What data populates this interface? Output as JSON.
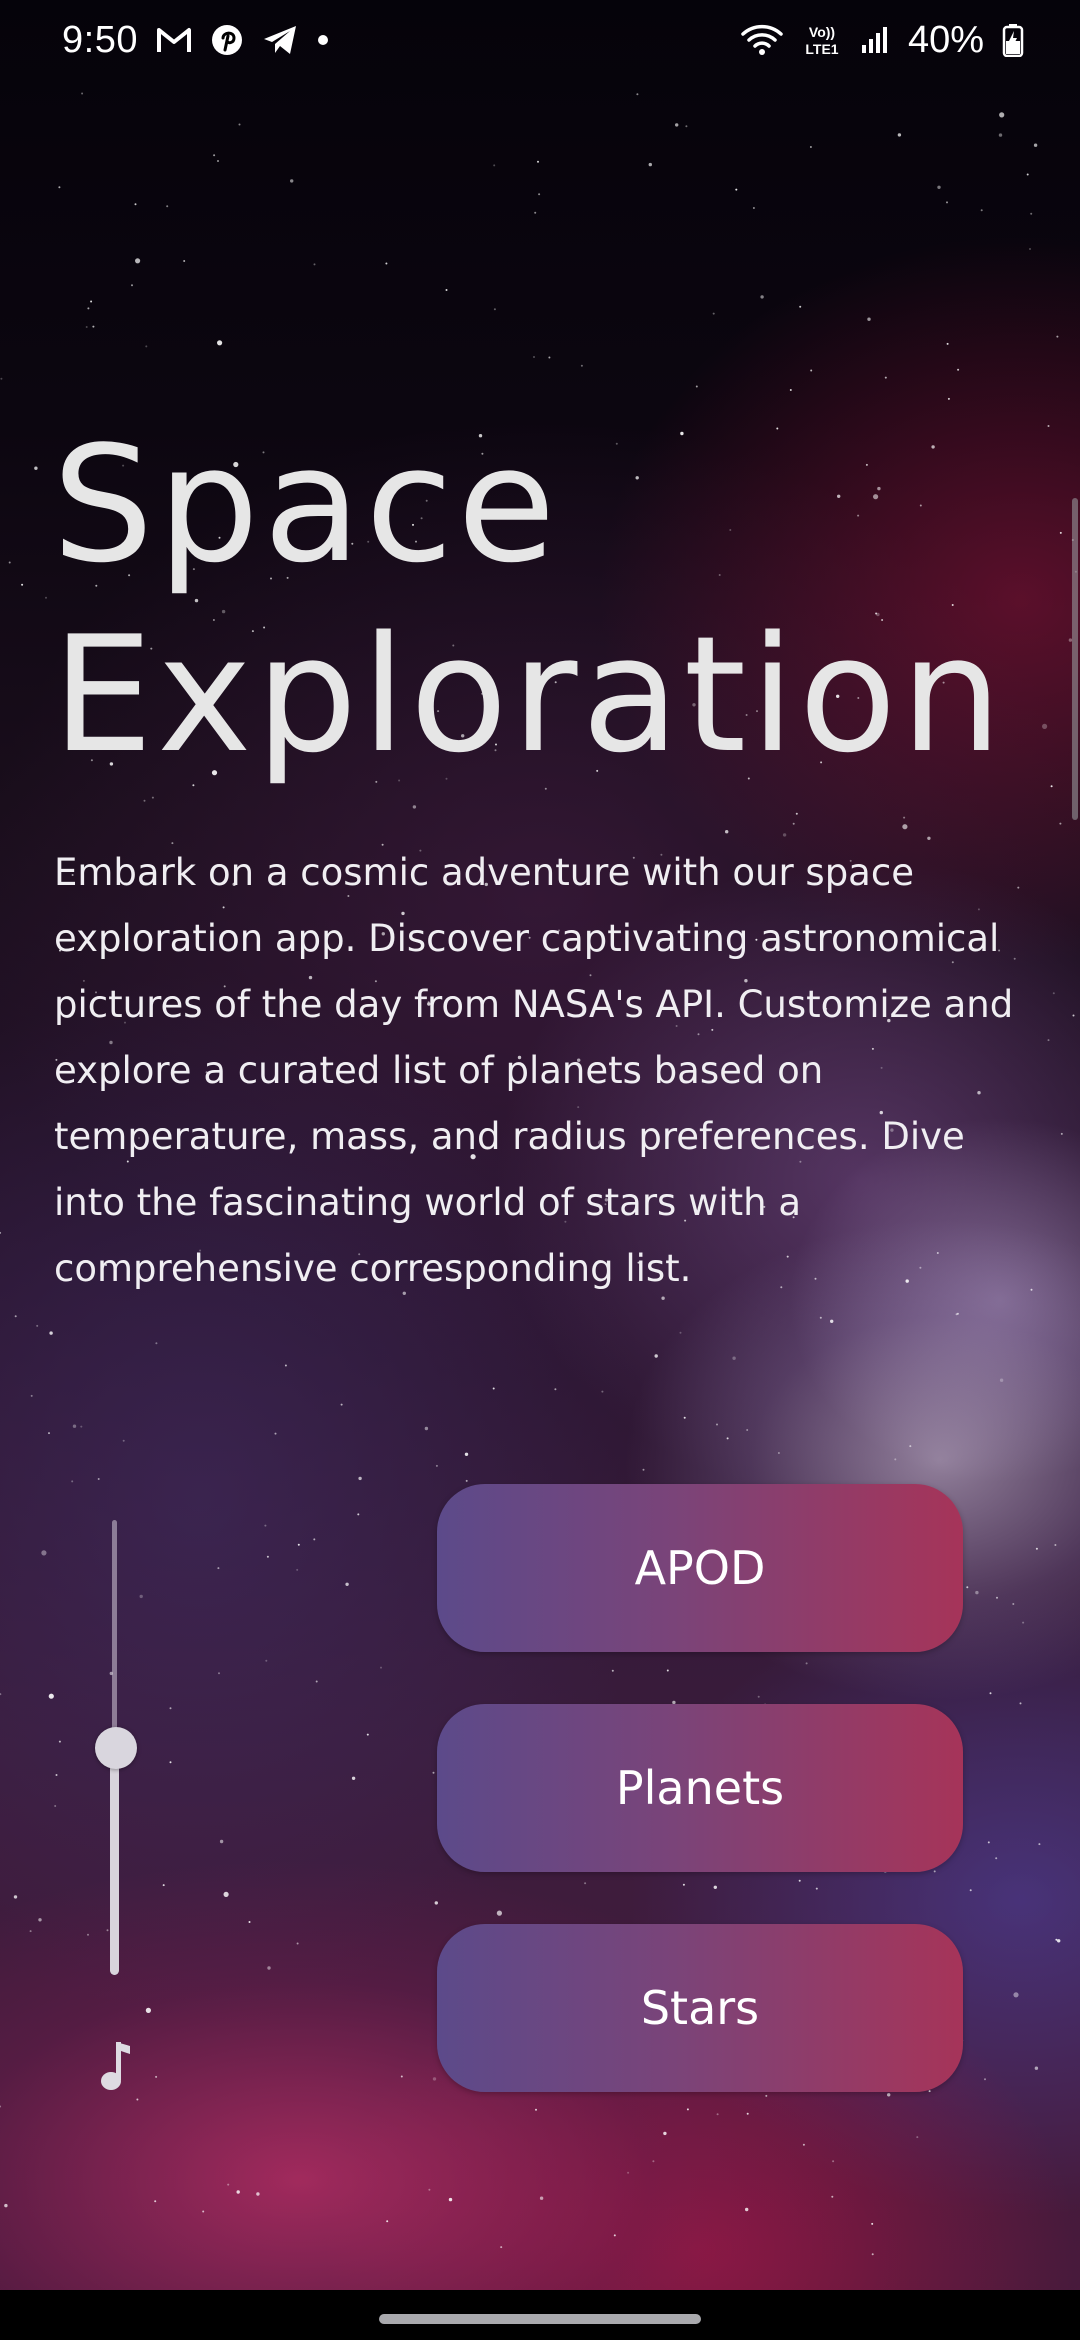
{
  "status_bar": {
    "time": "9:50",
    "notification_icons": [
      "gmail-icon",
      "pinterest-icon",
      "telegram-icon",
      "dot-icon"
    ],
    "system_icons": [
      "wifi-icon",
      "volte-lte-icon",
      "signal-icon"
    ],
    "volte_label_top": "Vo))",
    "volte_label_bottom": "LTE1",
    "battery_percent": "40%"
  },
  "main": {
    "title_line1": "Space",
    "title_line2": "Exploration",
    "description": "Embark on a cosmic adventure with our space exploration app. Discover captivating astronomical pictures of the day from NASA's API. Customize and explore a curated list of planets based on temperature, mass, and radius preferences. Dive into the fascinating world of stars with a comprehensive corresponding list."
  },
  "volume_slider": {
    "level": 0.5,
    "icon": "music-note-icon"
  },
  "buttons": {
    "apod": "APOD",
    "planets": "Planets",
    "stars": "Stars"
  },
  "colors": {
    "button_gradient_start": "#5c4a8a",
    "button_gradient_end": "#a63459",
    "title_color": "#e6e6e6",
    "text_color": "#f0eef2"
  }
}
